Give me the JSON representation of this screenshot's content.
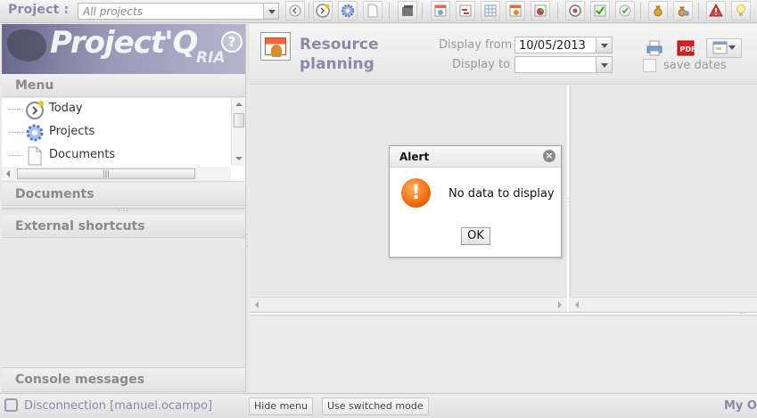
{
  "toolbar": {
    "project_label": "Project :",
    "project_select_value": "All projects"
  },
  "logo": {
    "text": "Project'Q",
    "suffix": "RIA",
    "help_glyph": "?"
  },
  "left_panel": {
    "menu_title": "Menu",
    "menu_items": [
      {
        "label": "Today",
        "icon": "clock-icon"
      },
      {
        "label": "Projects",
        "icon": "gear-icon"
      },
      {
        "label": "Documents",
        "icon": "document-icon"
      }
    ],
    "documents_title": "Documents",
    "external_shortcuts_title": "External shortcuts",
    "console_messages_title": "Console messages"
  },
  "resource_planning": {
    "title_line1": "Resource",
    "title_line2": "planning",
    "display_from_label": "Display from",
    "display_from_value": "10/05/2013",
    "display_to_label": "Display to",
    "display_to_value": "",
    "save_dates_label": "save dates",
    "save_dates_checked": false
  },
  "alert": {
    "title": "Alert",
    "message": "No data to display",
    "ok_label": "OK",
    "close_glyph": "×",
    "warn_glyph": "!"
  },
  "bottom_bar": {
    "disconnection_label": "Disconnection [manuel.ocampo]",
    "hide_menu_label": "Hide menu",
    "switched_mode_label": "Use switched mode",
    "right_label": "My O"
  },
  "colors": {
    "accent": "#8a8aa8",
    "warning": "#f26b0e",
    "pdf_red": "#d32020"
  }
}
